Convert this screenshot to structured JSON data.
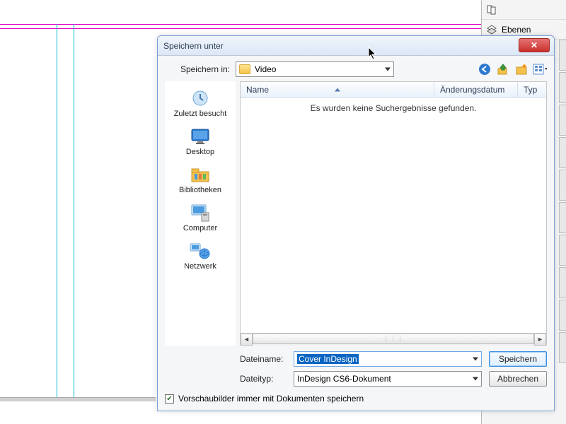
{
  "panel": {
    "layers_label": "Ebenen"
  },
  "dialog": {
    "title": "Speichern unter",
    "save_in_label": "Speichern in:",
    "folder_name": "Video",
    "columns": {
      "name": "Name",
      "date": "Änderungsdatum",
      "type": "Typ"
    },
    "empty_message": "Es wurden keine Suchergebnisse gefunden.",
    "filename_label": "Dateiname:",
    "filetype_label": "Dateityp:",
    "filename_value": "Cover InDesign",
    "filetype_value": "InDesign CS6-Dokument",
    "save_button": "Speichern",
    "cancel_button": "Abbrechen",
    "checkbox_label": "Vorschaubilder immer mit Dokumenten speichern",
    "places": {
      "recent": "Zuletzt besucht",
      "desktop": "Desktop",
      "libraries": "Bibliotheken",
      "computer": "Computer",
      "network": "Netzwerk"
    }
  }
}
